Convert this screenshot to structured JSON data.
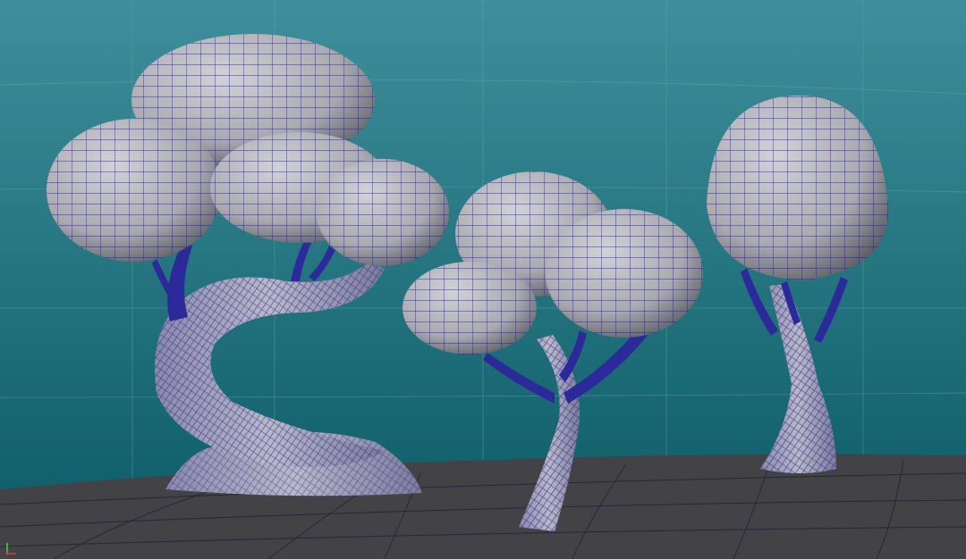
{
  "viewport": {
    "background_top": "#3a8e9a",
    "background_bottom": "#0a5a66",
    "ground_color": "#454545",
    "mesh_fill": "#b7b7bc",
    "mesh_shadow": "#6e6e74",
    "wire_color": "#1c1a78",
    "grid_color": "#6fa6ad",
    "ground_grid_color": "#2a2a33"
  },
  "axis_gizmo": {
    "icon": "axis-gizmo-icon",
    "x_color": "#d93a3a",
    "y_color": "#3ad93a"
  }
}
